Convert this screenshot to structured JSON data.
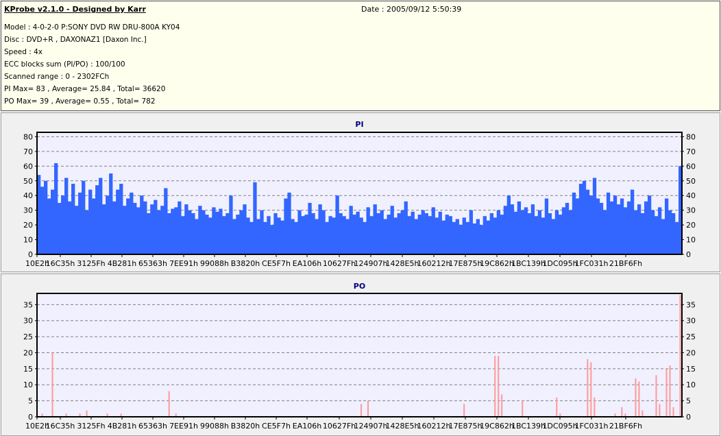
{
  "info": {
    "title": "KProbe v2.1.0 - Designed by Karr",
    "date": "Date : 2005/09/12 5:50:39",
    "lines": [
      "Model : 4-0-2-0 P:SONY    DVD RW DRU-800A  KY04",
      "Disc : DVD+R , DAXONAZ1 [Daxon Inc.]",
      "Speed : 4x",
      "ECC blocks sum (PI/PO) : 100/100",
      "Scanned range : 0 - 2302FCh",
      "PI Max= 83 , Average= 25.84 , Total= 36620",
      "PO Max= 39 , Average= 0.55 , Total= 782"
    ]
  },
  "chart_data": [
    {
      "type": "bar",
      "title": "PI",
      "color": "#3366ff",
      "background": "#f0f0ff",
      "grid": true,
      "ylim": [
        0,
        83
      ],
      "yticks": [
        0,
        10,
        20,
        30,
        40,
        50,
        60,
        70,
        80
      ],
      "xtick_labels": [
        "10E2h",
        "16C35h",
        "3125Fh",
        "4B281h",
        "65363h",
        "7EE91h",
        "99088h",
        "B3820h",
        "CE5F7h",
        "EA106h",
        "10627Fh",
        "124907h",
        "1428E5h",
        "160212h",
        "17E875h",
        "19C862h",
        "1BC139h",
        "1DC095h",
        "1FC031h",
        "21BF6Fh"
      ],
      "values": [
        54,
        46,
        50,
        38,
        44,
        62,
        35,
        40,
        52,
        36,
        48,
        33,
        42,
        50,
        30,
        44,
        38,
        47,
        52,
        34,
        40,
        55,
        36,
        44,
        48,
        33,
        38,
        42,
        35,
        32,
        40,
        36,
        28,
        34,
        37,
        30,
        33,
        45,
        28,
        31,
        32,
        36,
        26,
        34,
        30,
        28,
        24,
        33,
        30,
        27,
        25,
        32,
        29,
        31,
        26,
        28,
        40,
        24,
        27,
        30,
        34,
        25,
        22,
        49,
        24,
        30,
        22,
        26,
        20,
        28,
        25,
        23,
        38,
        42,
        24,
        22,
        30,
        26,
        27,
        35,
        28,
        24,
        34,
        30,
        22,
        26,
        25,
        40,
        28,
        26,
        24,
        33,
        27,
        29,
        25,
        22,
        32,
        26,
        34,
        28,
        30,
        24,
        27,
        33,
        25,
        28,
        30,
        36,
        26,
        29,
        24,
        27,
        30,
        28,
        26,
        32,
        25,
        29,
        23,
        27,
        26,
        22,
        24,
        20,
        25,
        22,
        30,
        21,
        24,
        20,
        26,
        23,
        28,
        25,
        30,
        27,
        33,
        40,
        34,
        29,
        36,
        30,
        32,
        28,
        34,
        26,
        30,
        25,
        38,
        28,
        24,
        30,
        27,
        32,
        35,
        30,
        42,
        38,
        48,
        50,
        44,
        40,
        52,
        38,
        35,
        30,
        42,
        36,
        40,
        34,
        38,
        32,
        36,
        44,
        30,
        34,
        28,
        36,
        40,
        30,
        26,
        32,
        24,
        38,
        30,
        28,
        22,
        60
      ]
    },
    {
      "type": "bar",
      "title": "PO",
      "color": "#ff9999",
      "background": "#f0f0ff",
      "grid": true,
      "ylim": [
        0,
        38.5
      ],
      "yticks": [
        0,
        5,
        10,
        15,
        20,
        25,
        30,
        35
      ],
      "xtick_labels": [
        "10E2h",
        "16C35h",
        "3125Fh",
        "4B281h",
        "65363h",
        "7EE91h",
        "99088h",
        "B3820h",
        "CE5F7h",
        "EA106h",
        "10627Fh",
        "124907h",
        "1428E5h",
        "160212h",
        "17E875h",
        "19C862h",
        "1BC139h",
        "1DC095h",
        "1FC031h",
        "21BF6Fh"
      ],
      "values": [
        0,
        1,
        0,
        0,
        20,
        0,
        0,
        0,
        1,
        0,
        0,
        0,
        1,
        0,
        2,
        0,
        0,
        0,
        0,
        0,
        1,
        0,
        0,
        0,
        1,
        0,
        0,
        0,
        0,
        0,
        0,
        0,
        0,
        0,
        0,
        0,
        0,
        0,
        8,
        0,
        1,
        0,
        0,
        0,
        0,
        0,
        0,
        0,
        0,
        0,
        0,
        0,
        0,
        0,
        0,
        0,
        0,
        0,
        0,
        0,
        0,
        0,
        0,
        0,
        0,
        0,
        0,
        0,
        0,
        0,
        0,
        0,
        0,
        0,
        0,
        0,
        0,
        0,
        0,
        0,
        0,
        0,
        0,
        0,
        0,
        0,
        0,
        0,
        0,
        0,
        0,
        0,
        0,
        0,
        4,
        0,
        5,
        0,
        0,
        0,
        0,
        0,
        0,
        0,
        0,
        0,
        0,
        0,
        0,
        0,
        0,
        0,
        0,
        0,
        0,
        0,
        0,
        0,
        0,
        0,
        0,
        0,
        0,
        0,
        4,
        0,
        0,
        0,
        0,
        0,
        0,
        0,
        0,
        19,
        19,
        7,
        0,
        0,
        0,
        0,
        0,
        5,
        0,
        0,
        0,
        0,
        0,
        0,
        0,
        0,
        0,
        6,
        1,
        0,
        0,
        0,
        0,
        0,
        0,
        0,
        18,
        17,
        6,
        0,
        0,
        0,
        0,
        0,
        1,
        0,
        3,
        1,
        0,
        0,
        12,
        11,
        2,
        0,
        0,
        0,
        13,
        4,
        0,
        15,
        16,
        3,
        0,
        38
      ]
    }
  ]
}
